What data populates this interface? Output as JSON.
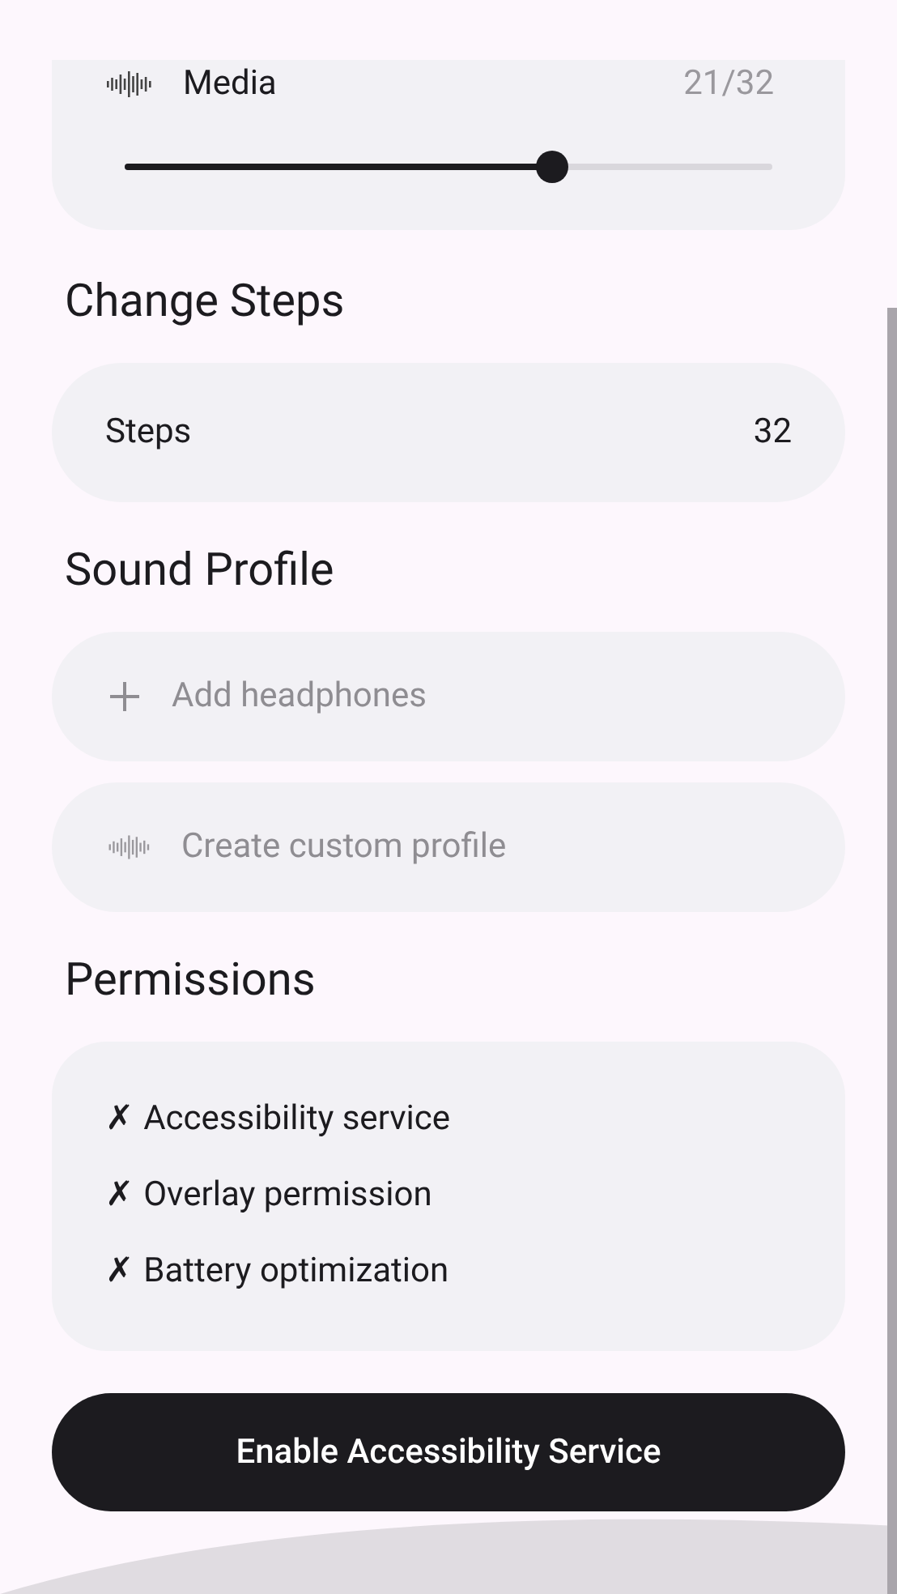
{
  "volume_card": {
    "label": "Media",
    "reading": "21/32",
    "level": 0.66
  },
  "change_steps": {
    "heading": "Change Steps",
    "label": "Steps",
    "value": "32"
  },
  "sound_profile": {
    "heading": "Sound Profile",
    "items": [
      {
        "kind": "add",
        "label": "Add headphones"
      },
      {
        "kind": "wave",
        "label": "Create custom profile"
      }
    ]
  },
  "permissions": {
    "heading": "Permissions",
    "items": [
      {
        "mark": "✗",
        "label": "Accessibility service"
      },
      {
        "mark": "✗",
        "label": "Overlay permission"
      },
      {
        "mark": "✗",
        "label": "Battery optimization"
      }
    ]
  },
  "action_button": {
    "label": "Enable Accessibility Service"
  }
}
